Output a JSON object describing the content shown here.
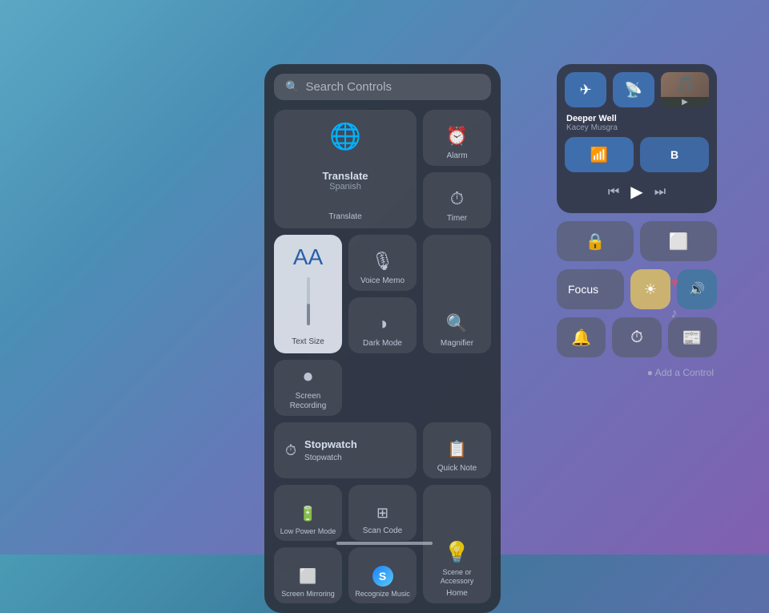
{
  "background": {
    "gradient": "linear-gradient(135deg, #5ba8c4 0%, #4a8fb5 25%, #6678b8 55%, #8060b0 100%)"
  },
  "search_controls": {
    "title": "Search Controls",
    "search_placeholder": "Search Controls",
    "controls": {
      "translate": {
        "title": "Translate",
        "subtitle": "Spanish",
        "label": "Translate"
      },
      "alarm": {
        "icon": "⏰",
        "label": "Alarm"
      },
      "timer": {
        "icon": "⏱",
        "label": "Timer"
      },
      "magnifier": {
        "icon": "🔍",
        "label": "Magnifier"
      },
      "voice_memo": {
        "icon": "🎙",
        "label": "Voice Memo"
      },
      "dark_mode": {
        "icon": "◑",
        "label": "Dark Mode"
      },
      "text_size": {
        "label": "Text Size",
        "aa": "AA"
      },
      "screen_recording": {
        "icon": "⏺",
        "label": "Screen Recording"
      },
      "stopwatch": {
        "icon": "⏱",
        "label": "Stopwatch",
        "title": "Stopwatch"
      },
      "quick_note": {
        "icon": "🖼",
        "label": "Quick Note"
      },
      "low_power_mode": {
        "icon": "🔋",
        "label": "Low Power Mode"
      },
      "scan_code": {
        "icon": "⊞",
        "label": "Scan Code"
      },
      "home": {
        "icon": "💡",
        "label": "Home",
        "scene": "Scene or Accessory"
      },
      "screen_mirroring": {
        "icon": "⬜",
        "label": "Screen Mirroring"
      },
      "recognize_music": {
        "label": "Recognize Music"
      }
    }
  },
  "right_panel": {
    "now_playing": {
      "song": "Deeper Well",
      "artist": "Kacey Musgra",
      "airplay_icon": "airplay",
      "buttons": {
        "airplane": "✈",
        "personal_hotspot": "📡",
        "wifi": "📶",
        "bluetooth": "⟨B⟩"
      },
      "transport": {
        "prev": "⏮",
        "play": "▶",
        "next": "⏭"
      }
    },
    "control_center": {
      "screen_lock": "🔒",
      "screen_mirroring": "⬜",
      "focus_label": "Focus",
      "brightness_icon": "☀",
      "volume_icon": "🔊",
      "heart_icon": "♥",
      "music_icon": "♪",
      "buttons": {
        "bell": "🔔",
        "timer": "⏱",
        "news": "📰"
      }
    },
    "add_control": "● Add a Control"
  }
}
